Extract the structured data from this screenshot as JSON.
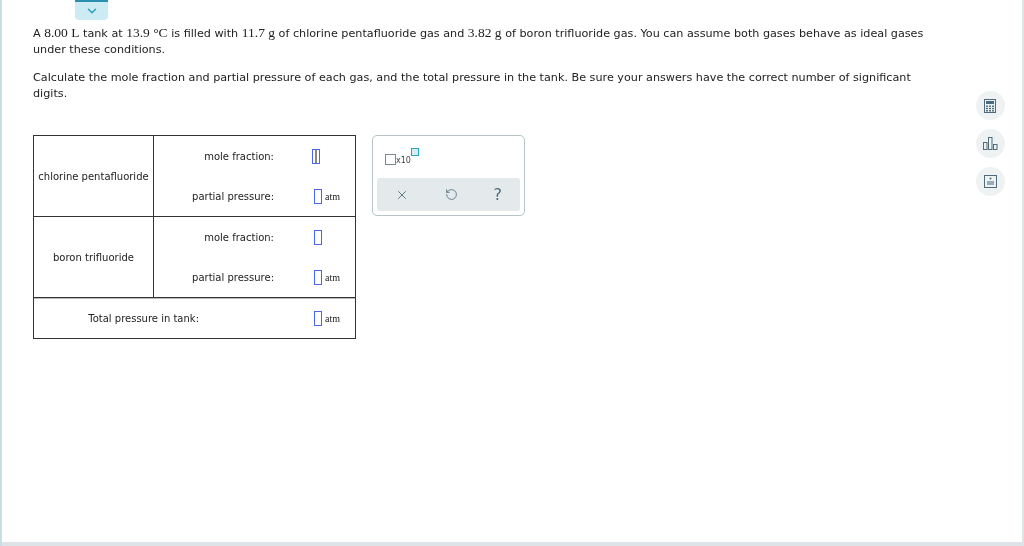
{
  "question": {
    "paragraphs": [
      [
        {
          "kind": "plain",
          "text": "A "
        },
        {
          "kind": "math",
          "text": "8.00 L"
        },
        {
          "kind": "plain",
          "text": " tank at "
        },
        {
          "kind": "math",
          "text": "13.9 °C"
        },
        {
          "kind": "plain",
          "text": " is filled with "
        },
        {
          "kind": "math",
          "text": "11.7 g"
        },
        {
          "kind": "plain",
          "text": " of chlorine pentafluoride gas and "
        },
        {
          "kind": "math",
          "text": "3.82 g"
        },
        {
          "kind": "plain",
          "text": " of boron trifluoride gas. You can assume both gases behave as ideal gases under these conditions."
        }
      ],
      [
        {
          "kind": "plain",
          "text": "Calculate the mole fraction and partial pressure of each gas, and the total pressure in the tank. Be sure your answers have the correct number of significant digits."
        }
      ]
    ]
  },
  "answer_table": {
    "gases": [
      {
        "name": "chlorine pentafluoride",
        "fields": [
          {
            "label": "mole fraction:",
            "focused": true
          },
          {
            "label": "partial pressure:",
            "unit": "atm",
            "focused": false
          }
        ]
      },
      {
        "name": "boron trifluoride",
        "fields": [
          {
            "label": "mole fraction:",
            "focused": false
          },
          {
            "label": "partial pressure:",
            "unit": "atm",
            "focused": false
          }
        ]
      }
    ],
    "total": {
      "label": "Total pressure in tank:",
      "unit": "atm",
      "focused": false
    }
  },
  "palette": {
    "exponent_label": "x10",
    "buttons": [
      {
        "kind": "clear"
      },
      {
        "kind": "undo"
      },
      {
        "kind": "help",
        "label": "?"
      }
    ]
  },
  "side_tools": [
    {
      "kind": "calculator"
    },
    {
      "kind": "chart"
    },
    {
      "kind": "periodic"
    }
  ]
}
